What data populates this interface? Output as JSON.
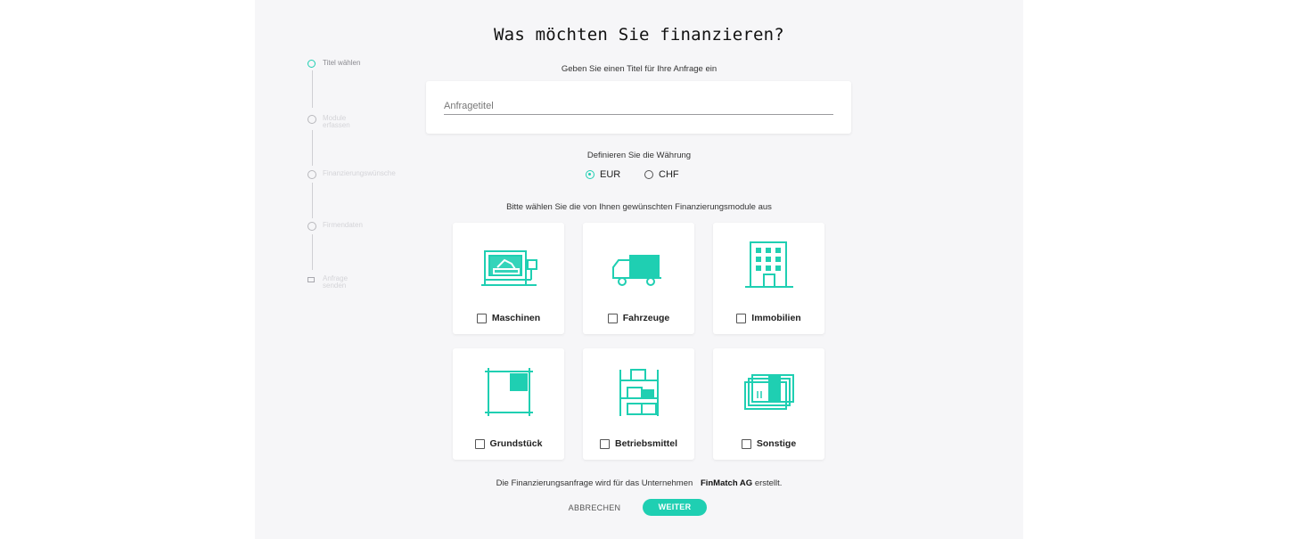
{
  "page": {
    "title": "Was möchten Sie finanzieren?"
  },
  "stepper": [
    {
      "label": "Titel wählen",
      "active": true
    },
    {
      "label": "Module erfassen",
      "active": false
    },
    {
      "label": "Finanzierungswünsche",
      "active": false
    },
    {
      "label": "Firmendaten",
      "active": false
    },
    {
      "label": "Anfrage senden",
      "active": false
    }
  ],
  "title_section": {
    "prompt": "Geben Sie einen Titel für Ihre Anfrage ein",
    "placeholder": "Anfragetitel",
    "value": ""
  },
  "currency": {
    "prompt": "Definieren Sie die Währung",
    "options": [
      "EUR",
      "CHF"
    ],
    "selected": "EUR"
  },
  "modules": {
    "prompt": "Bitte wählen Sie die von Ihnen gewünschten Finanzierungsmodule aus",
    "items": [
      {
        "label": "Maschinen",
        "icon": "machine-icon",
        "checked": false
      },
      {
        "label": "Fahrzeuge",
        "icon": "truck-icon",
        "checked": false
      },
      {
        "label": "Immobilien",
        "icon": "building-icon",
        "checked": false
      },
      {
        "label": "Grundstück",
        "icon": "land-plot-icon",
        "checked": false
      },
      {
        "label": "Betriebsmittel",
        "icon": "shelf-icon",
        "checked": false
      },
      {
        "label": "Sonstige",
        "icon": "cards-icon",
        "checked": false
      }
    ]
  },
  "footer": {
    "note": "Die Finanzierungsanfrage wird für das Unternehmen",
    "company": "FinMatch AG",
    "note_end": "erstellt.",
    "cancel_label": "ABBRECHEN",
    "next_label": "WEITER"
  },
  "colors": {
    "accent": "#1fcfb2",
    "panel_bg": "#f6f6f8",
    "card_bg": "#ffffff"
  }
}
